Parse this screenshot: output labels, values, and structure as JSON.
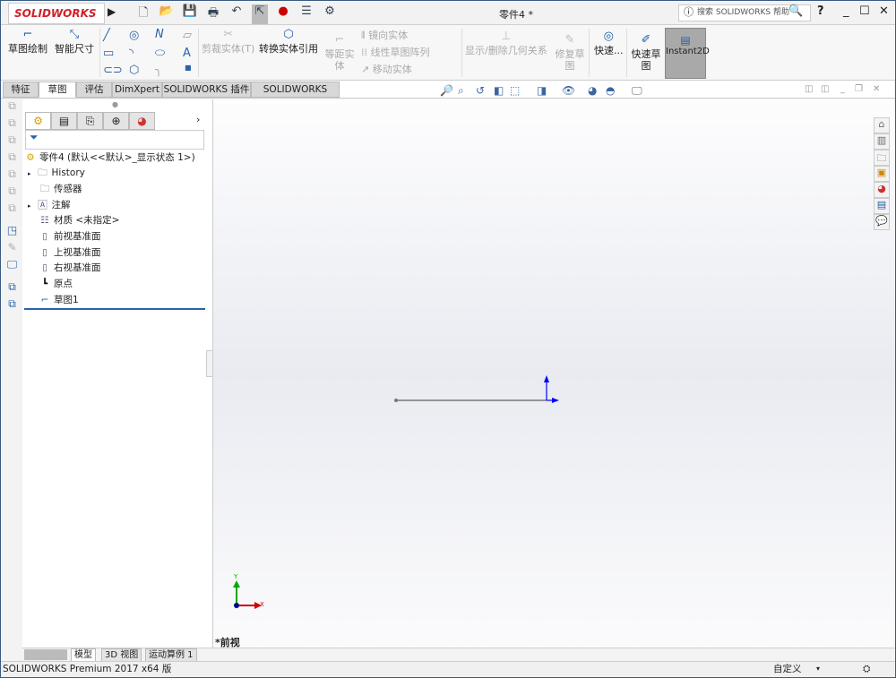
{
  "app": {
    "logo": "SOLIDWORKS",
    "title": "零件4 *",
    "search_placeholder": "搜索 SOLIDWORKS 帮助",
    "help": "?"
  },
  "quick_access": [
    "new-icon",
    "open-icon",
    "save-icon",
    "print-icon",
    "undo-icon",
    "select-icon",
    "rebuild-icon",
    "file-properties-icon",
    "options-icon"
  ],
  "ribbon": {
    "sketch": "草图绘制",
    "smart_dim": "智能尺寸",
    "trim": "剪裁实体(T)",
    "convert": "转换实体引用",
    "offset": "等距实体",
    "mirror": "镜向实体",
    "linear_pattern": "线性草图阵列",
    "move": "移动实体",
    "relations": "显示/删除几何关系",
    "repair": "修复草图",
    "quick_snap": "快速...",
    "rapid_sketch": "快速草图",
    "instant2d": "Instant2D"
  },
  "tabs": [
    "特征",
    "草图",
    "评估",
    "DimXpert",
    "SOLIDWORKS 插件",
    "SOLIDWORKS MBD"
  ],
  "active_tab": "草图",
  "tree": {
    "root": "零件4 (默认<<默认>_显示状态 1>)",
    "items": [
      "History",
      "传感器",
      "注解",
      "材质 <未指定>",
      "前视基准面",
      "上视基准面",
      "右视基准面",
      "原点",
      "草图1"
    ]
  },
  "view": {
    "label": "*前视",
    "triad_x": "X",
    "triad_y": "Y"
  },
  "bottom_tabs": [
    "模型",
    "3D 视图",
    "运动算例 1"
  ],
  "status": {
    "left": "SOLIDWORKS Premium 2017 x64 版",
    "units": "自定义"
  },
  "colors": {
    "brand": "#d2202a",
    "accent": "#1c5fa8",
    "sketch_axis": "#0000ff"
  }
}
